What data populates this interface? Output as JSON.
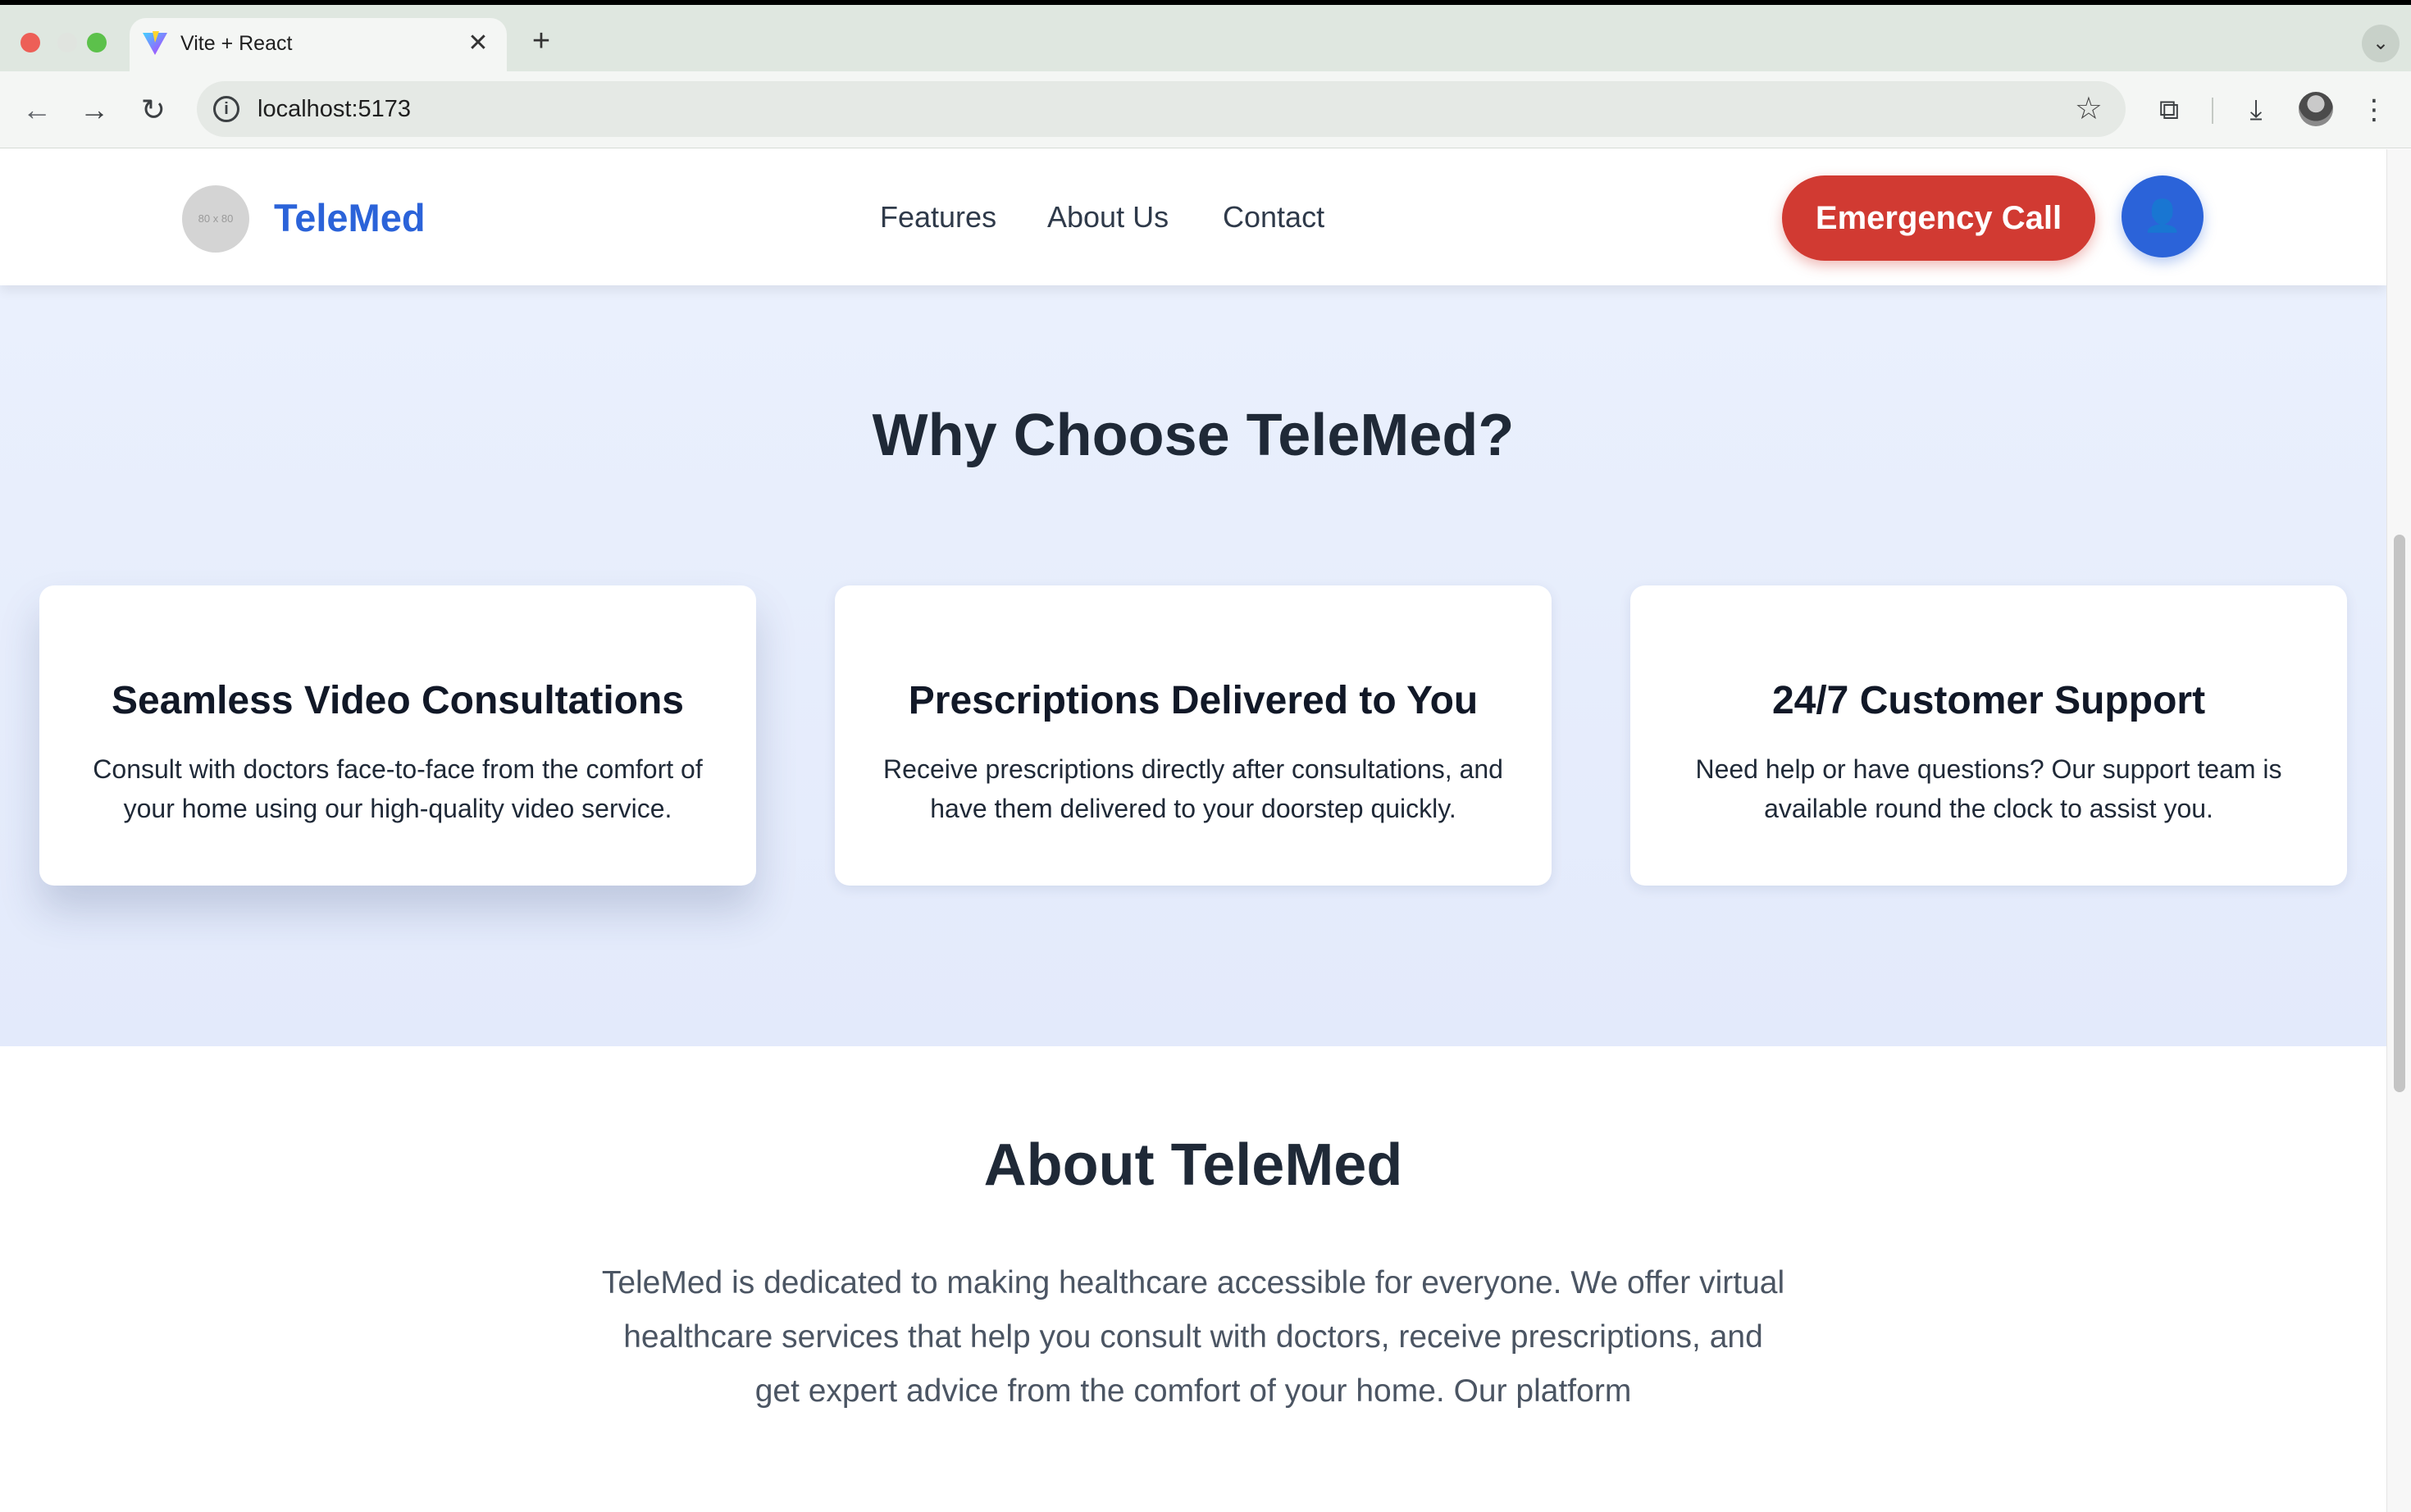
{
  "browser": {
    "tab_title": "Vite + React",
    "url": "localhost:5173",
    "icons": {
      "back": "arrow-left-icon",
      "forward": "arrow-right-icon",
      "reload": "reload-icon",
      "info": "info-icon",
      "bookmark": "star-icon",
      "extensions": "puzzle-icon",
      "downloads": "download-icon",
      "menu": "kebab-menu-icon"
    }
  },
  "header": {
    "logo_placeholder": "80 x 80",
    "brand": "TeleMed",
    "nav": [
      "Features",
      "About Us",
      "Contact"
    ],
    "emergency_label": "Emergency Call",
    "user_icon": "user-icon"
  },
  "features": {
    "title": "Why Choose TeleMed?",
    "cards": [
      {
        "title": "Seamless Video Consultations",
        "description": "Consult with doctors face-to-face from the comfort of your home using our high-quality video service."
      },
      {
        "title": "Prescriptions Delivered to You",
        "description": "Receive prescriptions directly after consultations, and have them delivered to your doorstep quickly."
      },
      {
        "title": "24/7 Customer Support",
        "description": "Need help or have questions? Our support team is available round the clock to assist you."
      }
    ]
  },
  "about": {
    "title": "About TeleMed",
    "body": "TeleMed is dedicated to making healthcare accessible for everyone. We offer virtual healthcare services that help you consult with doctors, receive prescriptions, and get expert advice from the comfort of your home. Our platform"
  },
  "colors": {
    "brand_blue": "#2b63d9",
    "emergency_red": "#d13a32",
    "section_bg": "#e6edfc"
  }
}
